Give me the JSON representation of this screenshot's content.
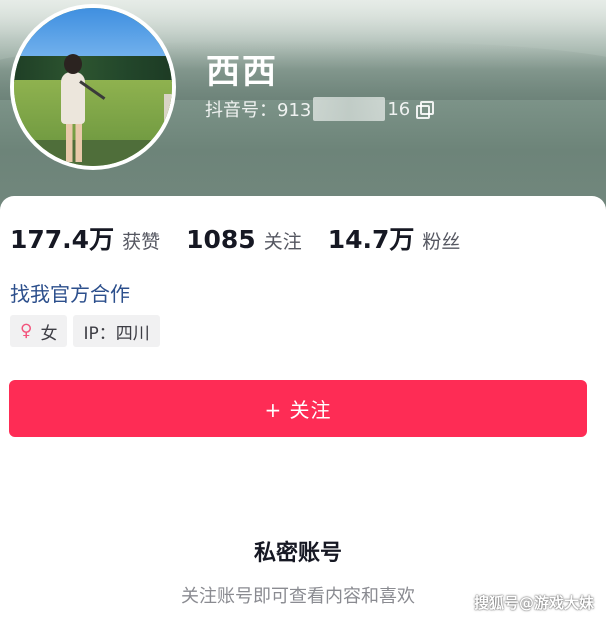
{
  "profile": {
    "name": "西西",
    "douyin_id_prefix": "抖音号：913",
    "douyin_id_suffix": "16"
  },
  "stats": [
    {
      "value": "177.4万",
      "label": "获赞"
    },
    {
      "value": "1085",
      "label": "关注"
    },
    {
      "value": "14.7万",
      "label": "粉丝"
    }
  ],
  "official_link": "找我官方合作",
  "tags": {
    "gender": "女",
    "ip": "IP：四川"
  },
  "follow_button": "+ 关注",
  "private": {
    "title": "私密账号",
    "description": "关注账号即可查看内容和喜欢"
  },
  "watermark": "搜狐号@游戏大妹",
  "icons": {
    "gender": "female-icon",
    "copy": "copy-icon"
  },
  "colors": {
    "accent": "#fe2c55",
    "link": "#2c4f8c",
    "female": "#f2547c"
  }
}
